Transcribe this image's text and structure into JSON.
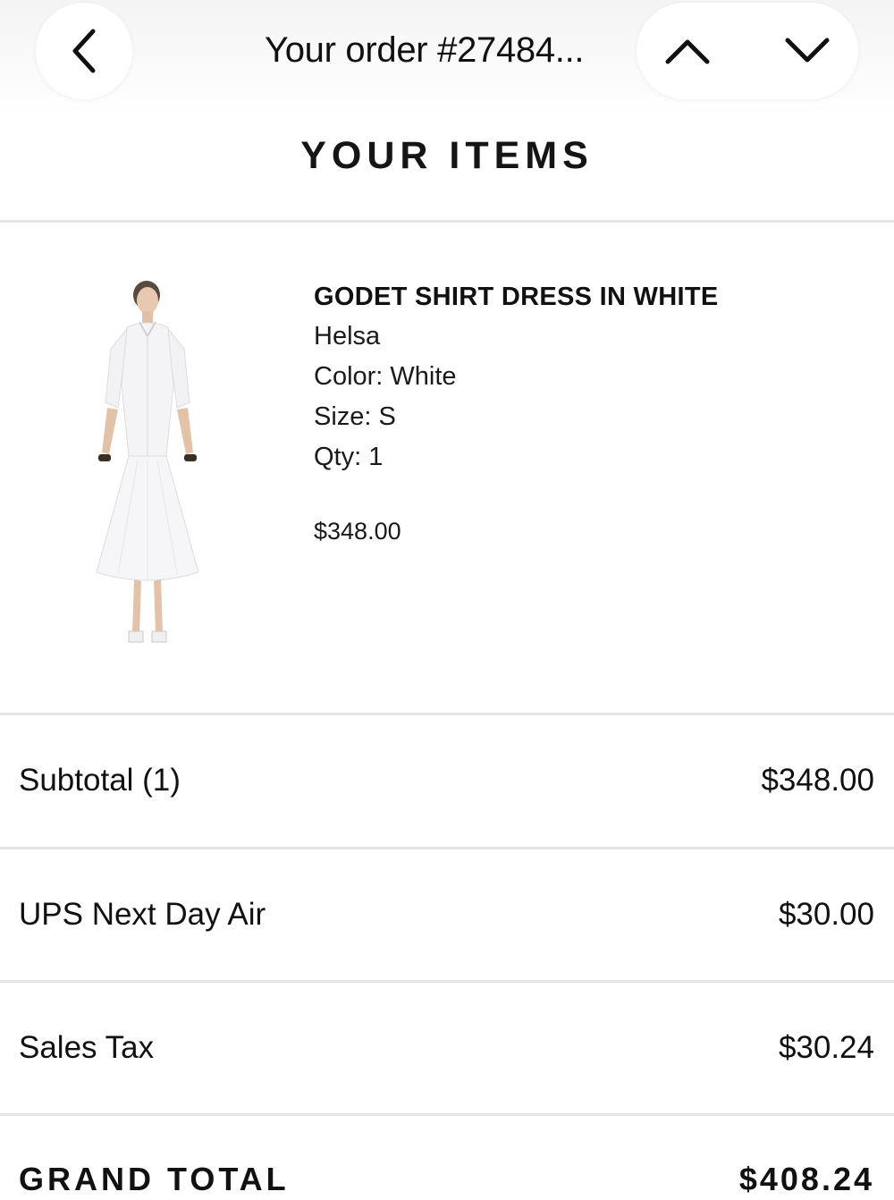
{
  "header": {
    "title": "Your order #27484...",
    "back_icon": "chevron-left-icon",
    "prev_icon": "chevron-up-icon",
    "next_icon": "chevron-down-icon"
  },
  "section": {
    "heading": "YOUR ITEMS"
  },
  "item": {
    "name": "GODET SHIRT DRESS IN WHITE",
    "brand": "Helsa",
    "color": "Color: White",
    "size": "Size: S",
    "qty": "Qty: 1",
    "price": "$348.00"
  },
  "summary": {
    "rows": [
      {
        "label": "Subtotal (1)",
        "value": "$348.00"
      },
      {
        "label": "UPS Next Day Air",
        "value": "$30.00"
      },
      {
        "label": "Sales Tax",
        "value": "$30.24"
      }
    ],
    "grand_total_label": "GRAND TOTAL",
    "grand_total_value": "$408.24"
  },
  "colors": {
    "text": "#111111",
    "divider": "#e4e4e4",
    "background": "#ffffff"
  }
}
